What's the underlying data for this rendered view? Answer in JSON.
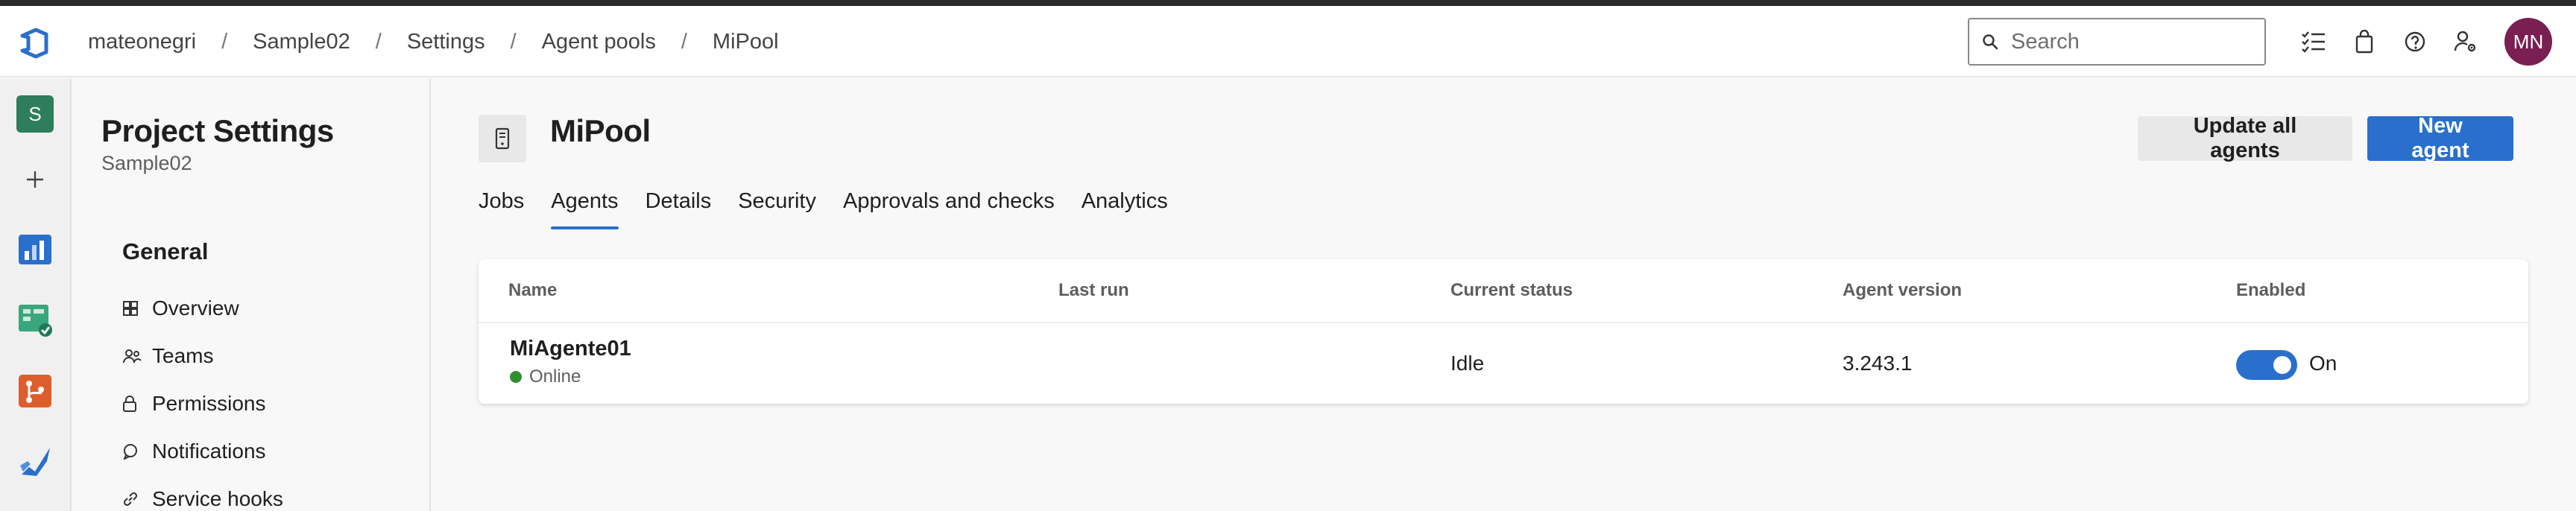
{
  "breadcrumb": [
    "mateonegri",
    "Sample02",
    "Settings",
    "Agent pools",
    "MiPool"
  ],
  "search": {
    "placeholder": "Search"
  },
  "user": {
    "initials": "MN"
  },
  "rail": {
    "project_initial": "S"
  },
  "settings_nav": {
    "title": "Project Settings",
    "project": "Sample02",
    "section": "General",
    "items": [
      {
        "label": "Overview",
        "icon": "overview-icon"
      },
      {
        "label": "Teams",
        "icon": "teams-icon"
      },
      {
        "label": "Permissions",
        "icon": "lock-icon"
      },
      {
        "label": "Notifications",
        "icon": "chat-icon"
      },
      {
        "label": "Service hooks",
        "icon": "link-icon"
      }
    ]
  },
  "pool": {
    "title": "MiPool"
  },
  "actions": {
    "update_all": "Update all agents",
    "new_agent": "New agent"
  },
  "tabs": [
    {
      "label": "Jobs",
      "active": false
    },
    {
      "label": "Agents",
      "active": true
    },
    {
      "label": "Details",
      "active": false
    },
    {
      "label": "Security",
      "active": false
    },
    {
      "label": "Approvals and checks",
      "active": false
    },
    {
      "label": "Analytics",
      "active": false
    }
  ],
  "table": {
    "headers": [
      "Name",
      "Last run",
      "Current status",
      "Agent version",
      "Enabled"
    ],
    "rows": [
      {
        "name": "MiAgente01",
        "status": "Online",
        "last_run": "",
        "current_status": "Idle",
        "version": "3.243.1",
        "enabled": "On"
      }
    ]
  },
  "colors": {
    "accent": "#2a6fcb",
    "online": "#2f8f2f",
    "avatar": "#7a1f52"
  }
}
